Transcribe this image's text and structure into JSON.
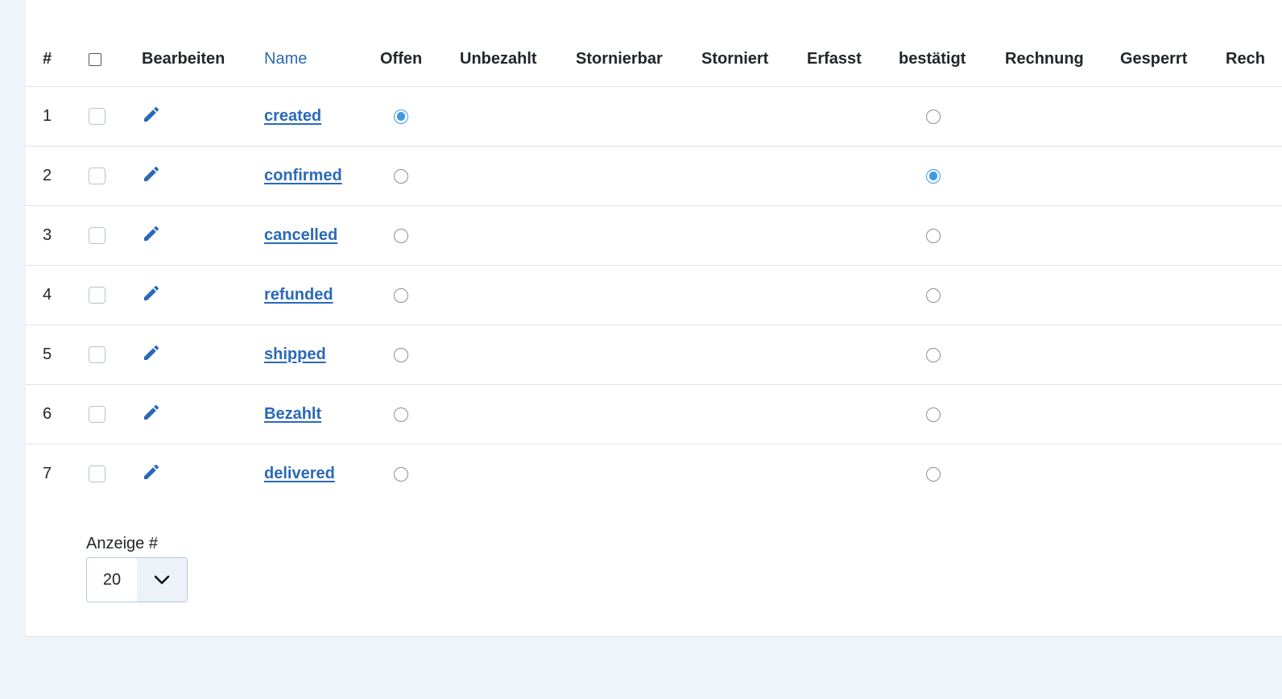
{
  "table": {
    "headers": {
      "num": "#",
      "edit": "Bearbeiten",
      "name": "Name",
      "offen": "Offen",
      "unbezahlt": "Unbezahlt",
      "stornierbar": "Stornierbar",
      "storniert": "Storniert",
      "erfasst": "Erfasst",
      "bestaetigt": "bestätigt",
      "rechnung": "Rechnung",
      "gesperrt": "Gesperrt",
      "rech": "Rech"
    },
    "rows": [
      {
        "num": "1",
        "name": "created",
        "offen": true,
        "bestaetigt": false
      },
      {
        "num": "2",
        "name": "confirmed",
        "offen": false,
        "bestaetigt": true
      },
      {
        "num": "3",
        "name": "cancelled",
        "offen": false,
        "bestaetigt": false
      },
      {
        "num": "4",
        "name": "refunded",
        "offen": false,
        "bestaetigt": false
      },
      {
        "num": "5",
        "name": "shipped",
        "offen": false,
        "bestaetigt": false
      },
      {
        "num": "6",
        "name": "Bezahlt",
        "offen": false,
        "bestaetigt": false
      },
      {
        "num": "7",
        "name": "delivered",
        "offen": false,
        "bestaetigt": false
      }
    ]
  },
  "pagination": {
    "limit_label": "Anzeige #",
    "limit_value": "20"
  },
  "icons": {
    "edit": "pencil-icon",
    "select_arrow": "chevron-down-icon"
  },
  "colors": {
    "link": "#2a69b8",
    "radio_selected": "#3d9ae8",
    "page_background": "#eff4fb"
  }
}
